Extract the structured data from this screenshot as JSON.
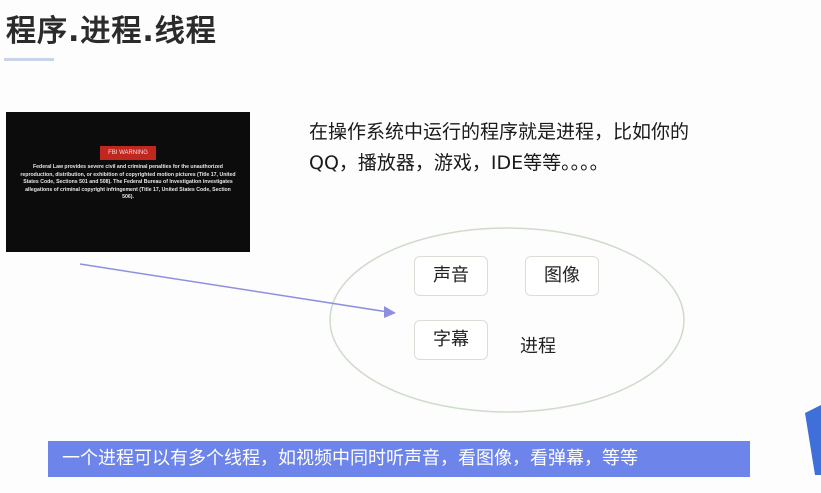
{
  "slide": {
    "title": "程序.进程.线程",
    "description_line1": "在操作系统中运行的程序就是进程，比如你的",
    "description_line2": "QQ，播放器，游戏，IDE等等。。。。",
    "video": {
      "badge": "FBI WARNING",
      "warning_text": "Federal Law provides severe civil and criminal penalties for the unauthorized reproduction, distribution, or exhibition of copyrighted motion pictures (Title 17, United States Code, Sections 501 and 508). The Federal Bureau of Investigation investigates allegations of criminal copyright infringement (Title 17, United States Code, Section 506)."
    },
    "diagram": {
      "boxes": [
        "声音",
        "图像",
        "字幕"
      ],
      "process_label": "进程"
    },
    "banner": "一个进程可以有多个线程，如视频中同时听声音，看图像，看弹幕，等等"
  },
  "colors": {
    "banner_bg": "#6d84ea",
    "arrow": "#8f8fe0",
    "ellipse_stroke": "#cfdccb",
    "fbi_badge": "#c0271f",
    "corner_accent": "#3f6fd8"
  }
}
